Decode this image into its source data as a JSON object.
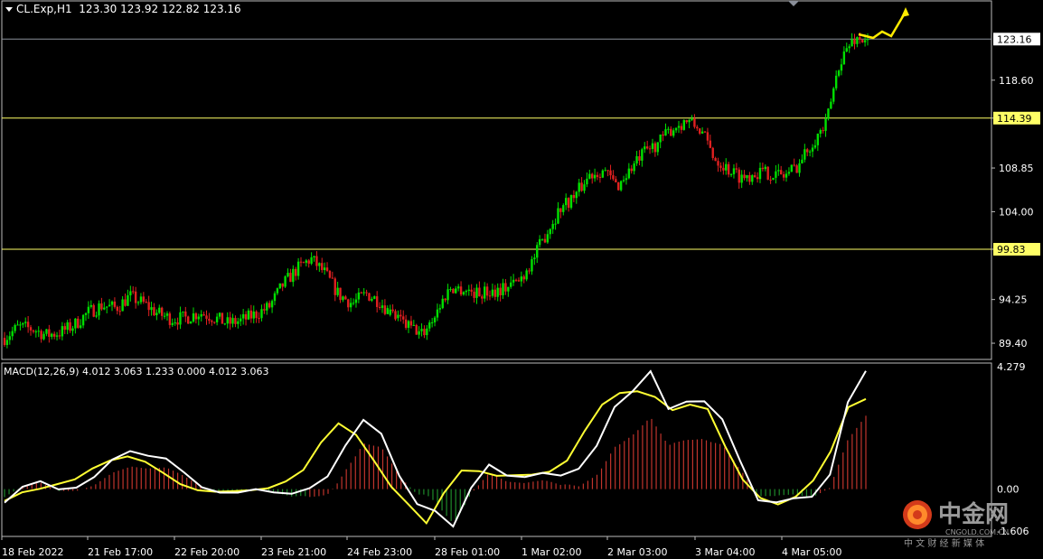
{
  "chart_data": [
    {
      "type": "candlestick",
      "symbol": "CL.Exp",
      "timeframe": "H1",
      "header": {
        "symbol_tf": "CL.Exp,H1",
        "ohlc": "123.30 123.92 122.82 123.16"
      },
      "ylim": [
        87.6,
        127.4
      ],
      "y_ticks": [
        "118.60",
        "114.39",
        "108.85",
        "104.00",
        "99.83",
        "94.25",
        "89.40"
      ],
      "x_ticks": [
        "18 Feb 2022",
        "21 Feb 17:00",
        "22 Feb 20:00",
        "23 Feb 21:00",
        "24 Feb 23:00",
        "28 Feb 01:00",
        "1 Mar 02:00",
        "2 Mar 03:00",
        "3 Mar 04:00",
        "4 Mar 05:00"
      ],
      "current_price": "123.16",
      "hlines": [
        {
          "value": 114.39,
          "label": "114.39",
          "color": "#ffff66"
        },
        {
          "value": 99.83,
          "label": "99.83",
          "color": "#ffff66"
        },
        {
          "value": 123.16,
          "label": "123.16",
          "color": "#8a8f99"
        }
      ],
      "path": [
        90.0,
        91.2,
        91.0,
        90.3,
        90.6,
        91.4,
        92.8,
        93.6,
        93.3,
        94.6,
        93.8,
        92.7,
        92.1,
        92.2,
        92.8,
        92.3,
        91.6,
        91.9,
        92.6,
        93.4,
        95.9,
        97.6,
        98.8,
        97.2,
        94.8,
        93.8,
        94.9,
        94.0,
        92.2,
        91.3,
        90.4,
        92.8,
        95.6,
        95.4,
        94.9,
        95.2,
        95.6,
        96.4,
        98.8,
        101.9,
        104.6,
        105.8,
        108.1,
        108.7,
        106.8,
        108.8,
        110.6,
        111.7,
        113.3,
        114.1,
        113.1,
        110.0,
        108.7,
        107.8,
        108.4,
        108.3,
        108.0,
        109.2,
        111.7,
        113.6,
        120.8,
        123.2,
        123.16
      ],
      "color_up": "#00e000",
      "color_down": "#e02020"
    },
    {
      "type": "macd",
      "label": "MACD(12,26,9) 4.012 3.063 1.233 0.000 4.012 3.063",
      "params": [
        12,
        26,
        9
      ],
      "values": {
        "macd": 4.012,
        "signal": 3.063,
        "histogram": 1.233
      },
      "ylim": [
        -1.606,
        4.279
      ],
      "y_ticks": [
        "4.279",
        "0.00",
        "-1.606"
      ],
      "macd_line": [
        -0.46,
        0.08,
        0.27,
        -0.01,
        0.05,
        0.41,
        1.0,
        1.29,
        1.13,
        1.04,
        0.57,
        0.06,
        -0.12,
        -0.12,
        0.0,
        -0.11,
        -0.16,
        0.03,
        0.43,
        1.48,
        2.35,
        1.88,
        0.45,
        -0.51,
        -0.74,
        -1.27,
        0.04,
        0.83,
        0.46,
        0.41,
        0.55,
        0.46,
        0.69,
        1.47,
        2.79,
        3.32,
        4.0,
        2.72,
        2.97,
        2.98,
        2.37,
        0.95,
        -0.38,
        -0.45,
        -0.31,
        -0.26,
        0.49,
        2.95,
        4.01
      ],
      "signal_line": [
        -0.4,
        -0.11,
        0.01,
        0.17,
        0.33,
        0.7,
        0.97,
        1.11,
        0.93,
        0.56,
        0.17,
        -0.04,
        -0.09,
        -0.07,
        -0.04,
        0.03,
        0.26,
        0.65,
        1.58,
        2.23,
        1.84,
        0.98,
        0.08,
        -0.53,
        -1.16,
        -0.13,
        0.63,
        0.61,
        0.45,
        0.47,
        0.49,
        0.59,
        0.97,
        1.97,
        2.87,
        3.26,
        3.32,
        3.13,
        2.68,
        2.87,
        2.72,
        1.45,
        0.32,
        -0.3,
        -0.52,
        -0.26,
        0.29,
        1.28,
        2.78,
        3.06
      ]
    }
  ],
  "watermark": {
    "brand": "中金网",
    "site": "CNGOLD.COM.CN",
    "tagline": "中 文 财 经 新 媒 体"
  }
}
